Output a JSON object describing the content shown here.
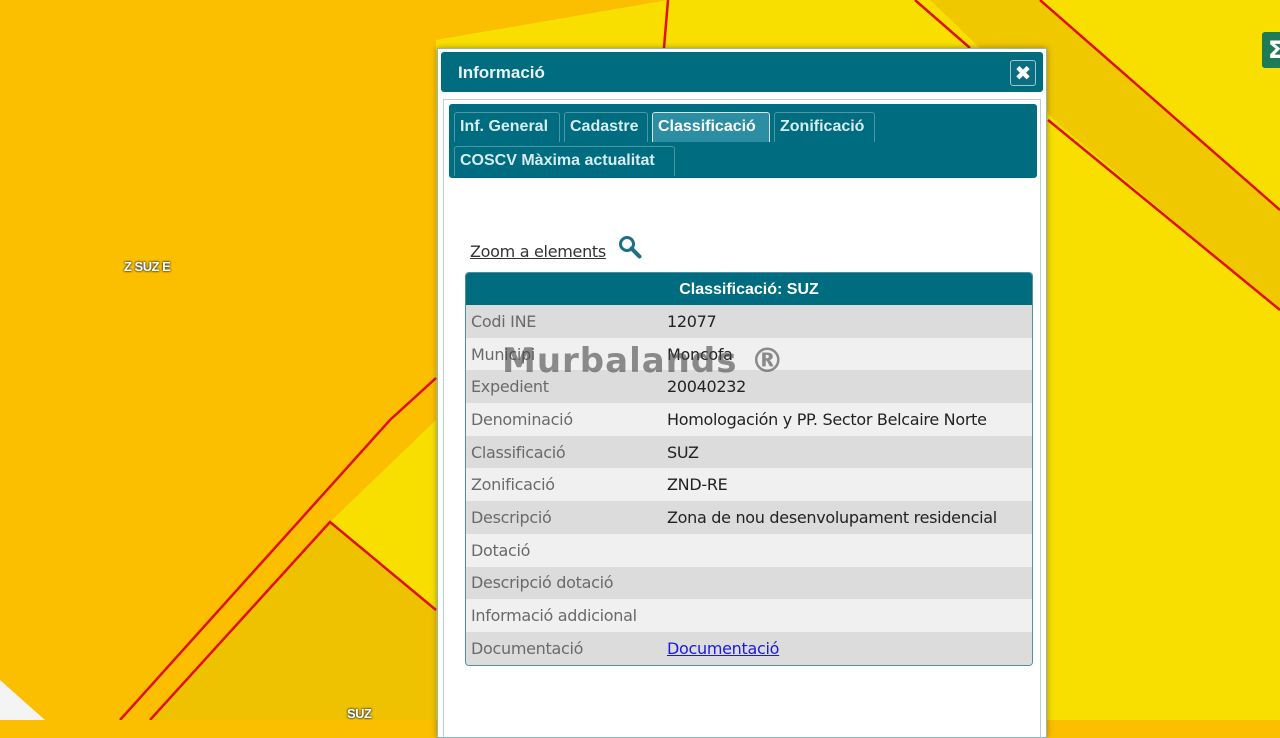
{
  "map": {
    "labels": [
      "Z SUZ E",
      "SUZ"
    ],
    "control_icon": "sigma-icon",
    "control_glyph": "Σ"
  },
  "dialog": {
    "title": "Informació",
    "close_glyph": "✖",
    "tabs": [
      {
        "label": "Inf. General",
        "active": false
      },
      {
        "label": "Cadastre",
        "active": false
      },
      {
        "label": "Classificació",
        "active": true
      },
      {
        "label": "Zonificació",
        "active": false
      },
      {
        "label": "COSCV Màxima actualitat",
        "active": false
      }
    ],
    "zoom_link": "Zoom a elements",
    "table": {
      "title": "Classificació: SUZ",
      "rows": [
        {
          "key": "Codi INE",
          "value": "12077"
        },
        {
          "key": "Municipi",
          "value": "Moncofa"
        },
        {
          "key": "Expedient",
          "value": "20040232"
        },
        {
          "key": "Denominació",
          "value": "Homologación y PP. Sector Belcaire Norte"
        },
        {
          "key": "Classificació",
          "value": "SUZ"
        },
        {
          "key": "Zonificació",
          "value": "ZND-RE"
        },
        {
          "key": "Descripció",
          "value": "Zona de nou desenvolupament residencial"
        },
        {
          "key": "Dotació",
          "value": ""
        },
        {
          "key": "Descripció dotació",
          "value": ""
        },
        {
          "key": "Informació addicional",
          "value": ""
        },
        {
          "key": "Documentació",
          "value": "Documentació"
        }
      ]
    }
  },
  "watermark": "Murbalands ®",
  "colors": {
    "header": "#006c80",
    "active_tab": "#2b8ea3",
    "map_orange": "#fbbf00",
    "map_yellow": "#f9e000",
    "boundary_red": "#e01010",
    "link_blue": "#1a1ae0"
  }
}
